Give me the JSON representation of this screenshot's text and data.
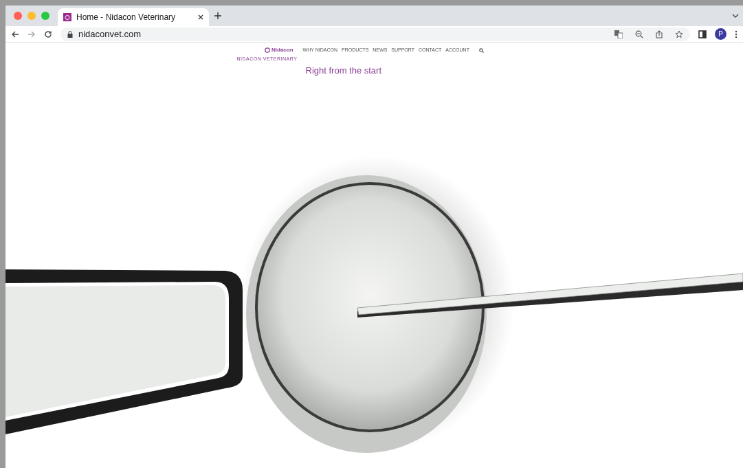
{
  "browser": {
    "tabs": [
      {
        "title": "Home - Nidacon Veterinary",
        "selected": true
      }
    ],
    "url": "nidaconvet.com",
    "profile_initial": "P"
  },
  "site": {
    "logo": "Nidacon",
    "nav": [
      "WHY NIDACON",
      "PRODUCTS",
      "NEWS",
      "SUPPORT",
      "CONTACT",
      "ACCOUNT"
    ],
    "eyebrow": "NIDACON VETERINARY",
    "headline": "Right from the start"
  }
}
